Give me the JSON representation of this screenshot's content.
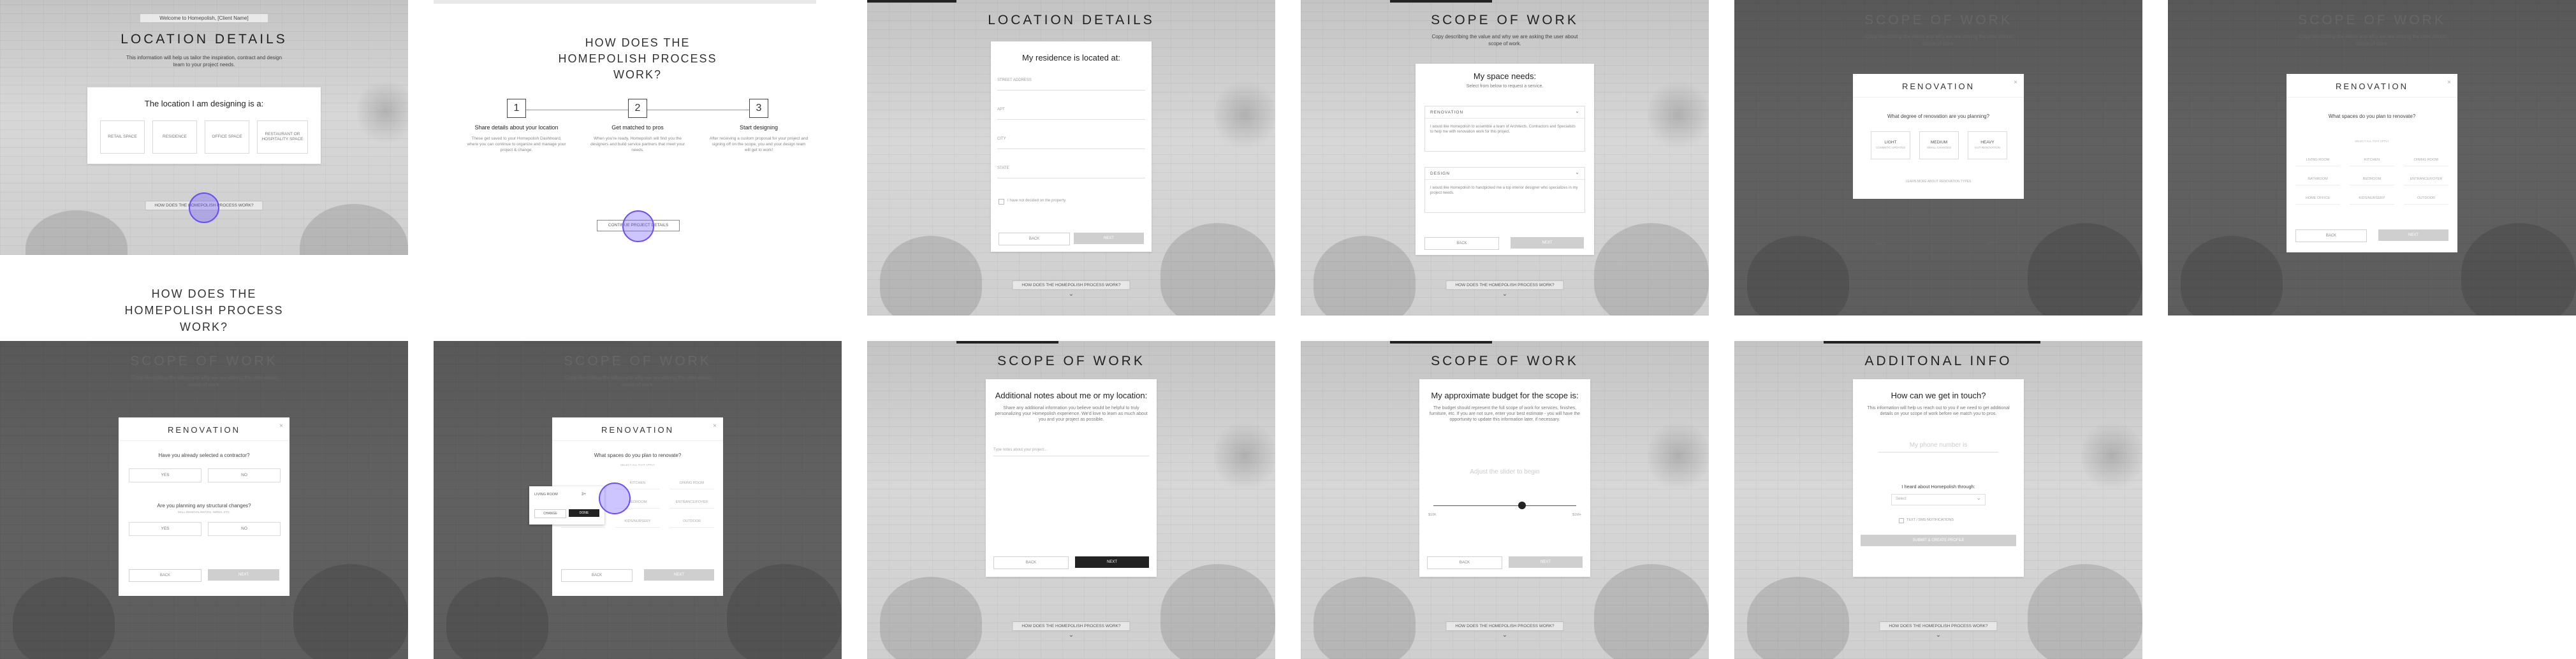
{
  "p1": {
    "banner": "Welcome to Homepolish, [Client Name]",
    "title": "LOCATION DETAILS",
    "subtitle": "This information will help us tailor the inspiration, contract and design team to your project needs.",
    "card_title": "The location I am designing is a:",
    "options": [
      "RETAIL SPACE",
      "RESIDENCE",
      "OFFICE SPACE",
      "RESTAURANT OR HOSPITALITY SPACE"
    ],
    "footer_link": "HOW DOES THE HOMEPOLISH PROCESS WORK?",
    "below_title": "HOW DOES THE HOMEPOLISH PROCESS WORK?"
  },
  "p2": {
    "title": "HOW DOES THE HOMEPOLISH PROCESS WORK?",
    "steps": [
      {
        "num": "1",
        "title": "Share details about your location",
        "text": "These get saved to your Homepolish Dashboard, where you can continue to organize and manage your project & change."
      },
      {
        "num": "2",
        "title": "Get matched to pros",
        "text": "When you're ready, Homepolish will find you the designers and build service partners that meet your needs."
      },
      {
        "num": "3",
        "title": "Start designing",
        "text": "After receiving a custom proposal for your project and signing off on the scope, you and your design team will get to work!"
      }
    ],
    "continue": "CONTINUE PROJECT DETAILS"
  },
  "p3": {
    "title": "LOCATION DETAILS",
    "card_title": "My residence is located at:",
    "fields": [
      "STREET ADDRESS",
      "APT",
      "CITY",
      "STATE"
    ],
    "checkbox": "I have not decided on the property.",
    "back": "BACK",
    "next": "NEXT",
    "footer_link": "HOW DOES THE HOMEPOLISH PROCESS WORK?"
  },
  "p4": {
    "title": "SCOPE OF WORK",
    "subtitle": "Copy describing the value and why we are asking the user about scope of work.",
    "card_title": "My space needs:",
    "card_sub": "Select from below to request a service.",
    "items": [
      {
        "label": "RENOVATION",
        "text": "I would like Homepolish to assemble a team of Architects, Contractors and Specialists to help me with renovation work for this project."
      },
      {
        "label": "DESIGN",
        "text": "I would like Homepolish to handpicked me a top interior designer who specializes in my project needs."
      }
    ],
    "back": "BACK",
    "next": "NEXT",
    "footer_link": "HOW DOES THE HOMEPOLISH PROCESS WORK?"
  },
  "p5": {
    "title": "SCOPE OF WORK",
    "subtitle": "Copy describing the value and why we are asking the user about scope of work.",
    "modal_title": "RENOVATION",
    "question": "What degree of renovation are you planning?",
    "options": [
      {
        "label": "LIGHT",
        "sub": "COSMETIC UPDATES"
      },
      {
        "label": "MEDIUM",
        "sub": "SMALL CHANGES"
      },
      {
        "label": "HEAVY",
        "sub": "GUT RENOVATION"
      }
    ],
    "note": "LEARN MORE ABOUT RENOVATION TYPES",
    "back": "BACK",
    "next": "NEXT"
  },
  "p6": {
    "title": "SCOPE OF WORK",
    "subtitle": "Copy describing the value and why we are asking the user about scope of work.",
    "modal_title": "RENOVATION",
    "question": "What spaces do you plan to renovate?",
    "hint": "SELECT ALL THAT APPLY",
    "spaces": [
      "LIVING ROOM",
      "KITCHEN",
      "DINING ROOM",
      "BATHROOM",
      "BEDROOM",
      "ENTRANCE/FOYER",
      "HOME OFFICE",
      "KIDS/NURSERY",
      "OUTDOOR"
    ],
    "back": "BACK",
    "next": "NEXT"
  },
  "p7": {
    "title": "SCOPE OF WORK",
    "subtitle": "Copy describing the value and why we are asking the user about scope of work.",
    "modal_title": "RENOVATION",
    "q1": "Have you already selected a contractor?",
    "q1_options": [
      "YES",
      "NO"
    ],
    "q2": "Are you planning any structural changes?",
    "q2_sub": "WALL REMOVAL/MOVES, WIRES, ETC.",
    "q2_options": [
      "YES",
      "NO"
    ],
    "back": "BACK",
    "next": "NEXT"
  },
  "p8": {
    "title": "SCOPE OF WORK",
    "subtitle": "Copy describing the value and why we are asking the user about scope of work.",
    "modal_title": "RENOVATION",
    "question": "What spaces do you plan to renovate?",
    "hint": "SELECT ALL THAT APPLY",
    "popover_room": "LIVING ROOM",
    "popover_count": "3+",
    "popover_tabs": [
      "CHANGE",
      "DONE"
    ],
    "spaces": [
      "LIVING ROOM",
      "KITCHEN",
      "DINING ROOM",
      "BATHROOM",
      "BEDROOM",
      "ENTRANCE/FOYER",
      "HOME OFFICE",
      "KIDS/NURSERY",
      "OUTDOOR"
    ],
    "back": "BACK",
    "next": "NEXT"
  },
  "p9": {
    "title": "SCOPE OF WORK",
    "card_title": "Additional notes about me or my location:",
    "card_text": "Share any additional information you believe would be helpful to truly personalizing your Homepolish experience. We'd love to learn as much about you and your project as possible.",
    "placeholder": "Type notes about your project...",
    "back": "BACK",
    "next": "NEXT",
    "footer_link": "HOW DOES THE HOMEPOLISH PROCESS WORK?"
  },
  "p10": {
    "title": "SCOPE OF WORK",
    "card_title": "My approximate budget for the scope is:",
    "card_text": "The budget should represent the full scope of work for services, finishes, furniture, etc. If you are not sure, enter your best estimate - you will have the opportunity to update this information later, if necessary.",
    "slider_label": "Adjust the slider to begin",
    "min": "$10K",
    "max": "$1M+",
    "slider_value": 0.62,
    "back": "BACK",
    "next": "NEXT",
    "footer_link": "HOW DOES THE HOMEPOLISH PROCESS WORK?"
  },
  "p11": {
    "title": "ADDITONAL INFO",
    "card_title": "How can we get in touch?",
    "card_text": "This information will help us reach out to you if we need to get additional details on your scope of work before we match you to pros.",
    "phone_placeholder": "My phone number is",
    "heard_label": "I heard about Homepolish through:",
    "select_placeholder": "Select",
    "checkbox": "TEXT / SMS NOTIFICATIONS",
    "submit": "SUBMIT & CREATE PROFILE",
    "footer_link": "HOW DOES THE HOMEPOLISH PROCESS WORK?"
  },
  "accent": "#6a4cff"
}
